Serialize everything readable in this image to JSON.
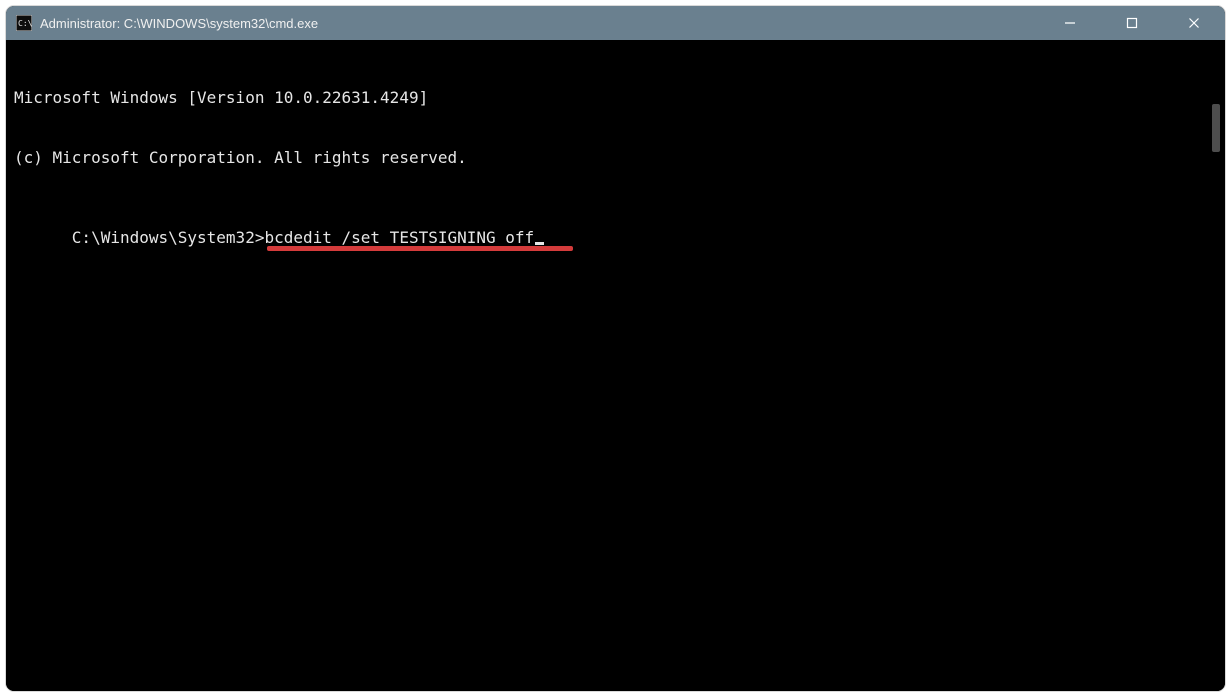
{
  "titlebar": {
    "title": "Administrator: C:\\WINDOWS\\system32\\cmd.exe"
  },
  "terminal": {
    "line1": "Microsoft Windows [Version 10.0.22631.4249]",
    "line2": "(c) Microsoft Corporation. All rights reserved.",
    "blank": "",
    "prompt": "C:\\Windows\\System32>",
    "command": "bcdedit /set TESTSIGNING off"
  },
  "annotation": {
    "underline_color": "#d43b3b"
  },
  "icons": {
    "app": "cmd-icon",
    "minimize": "minimize-icon",
    "maximize": "maximize-icon",
    "close": "close-icon"
  }
}
